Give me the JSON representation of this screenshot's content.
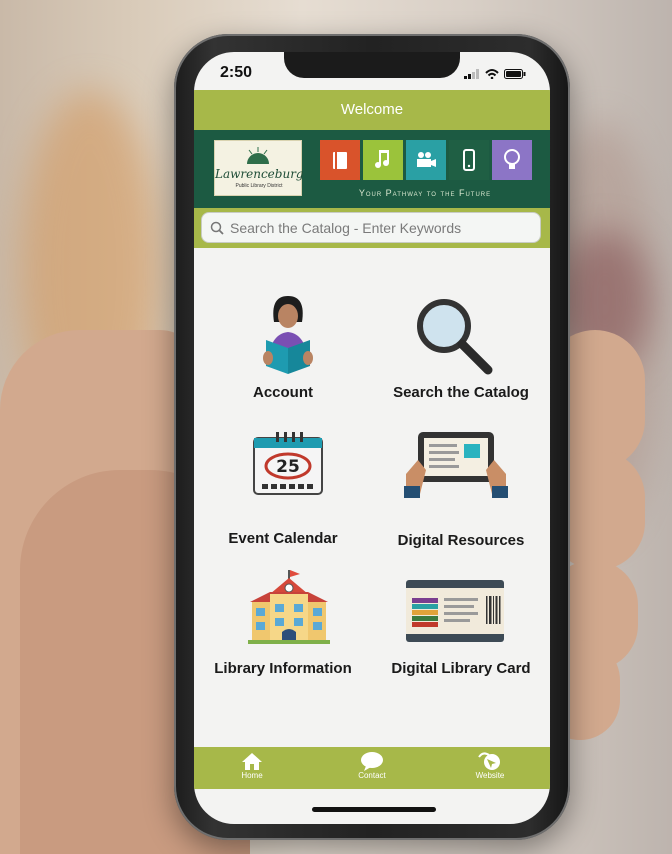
{
  "status_bar": {
    "time": "2:50"
  },
  "header": {
    "title": "Welcome"
  },
  "banner": {
    "logo_name": "Lawrenceburg",
    "logo_sub": "Public Library District",
    "tagline": "Your Pathway to the Future",
    "tiles": [
      {
        "icon": "book-icon",
        "color": "#d9532b"
      },
      {
        "icon": "music-note-icon",
        "color": "#9bc33b"
      },
      {
        "icon": "video-camera-icon",
        "color": "#2aa0a4"
      },
      {
        "icon": "phone-icon",
        "color": "#1f5f44"
      },
      {
        "icon": "lightbulb-icon",
        "color": "#8c75c6"
      }
    ]
  },
  "search": {
    "placeholder": "Search the Catalog - Enter Keywords"
  },
  "menu": {
    "account": "Account",
    "search_catalog": "Search the Catalog",
    "event_calendar": "Event Calendar",
    "calendar_day": "25",
    "digital_resources": "Digital Resources",
    "library_information": "Library Information",
    "digital_library_card": "Digital Library Card"
  },
  "footer": {
    "home": "Home",
    "contact": "Contact",
    "website": "Website"
  },
  "colors": {
    "accent": "#a7b849",
    "banner": "#1c5a42"
  }
}
